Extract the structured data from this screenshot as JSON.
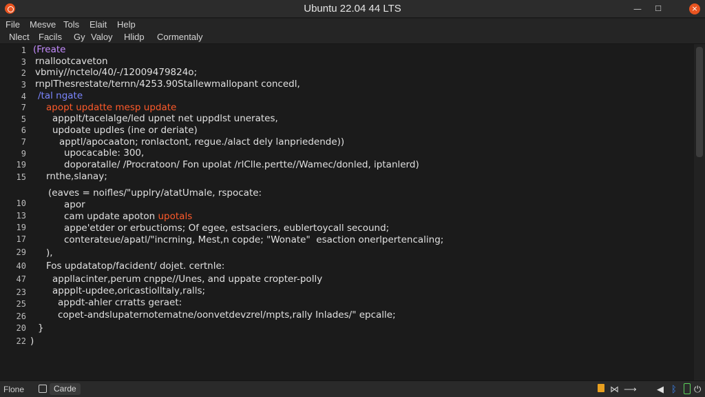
{
  "window": {
    "title": "Ubuntu 22.04 44 LTS",
    "minimize_glyph": "—",
    "maximize_glyph": "☐",
    "close_glyph": "×"
  },
  "menubar": [
    "File",
    "Mesve",
    "Tols",
    "Elait",
    "Help"
  ],
  "toolbar": [
    "Nlect",
    "Facils",
    "Gy",
    "Valoy",
    "Hlidp",
    "Cormentaly"
  ],
  "editor": {
    "line_numbers": [
      "1",
      "3",
      "2",
      "3",
      "4",
      "7",
      "5",
      "6",
      "7",
      "9",
      "19",
      "15",
      "10",
      "13",
      "19",
      "17",
      "29",
      "40",
      "47",
      "23",
      "25",
      "26",
      "20",
      "22"
    ],
    "lines": [
      "(Freate",
      "rnallootcaveton",
      "vbmiy//nctelo/40/-/12009479824o;",
      "rnplThesrestate/ternn/4253.90Stallewmallopant concedl,",
      "/tal ngate",
      "apopt updatte mesp update",
      "appplt/tacelalge/led upnet net uppdlst unerates,",
      "updoate updles (ine or deriate)",
      "apptl/apocaaton; ronlactont, regue./alact dely lanpriedende))",
      "upocacable: 300,",
      "doporatalle/ /Procratoon/ Fon upolat /rlClle.pertte//Wamec/donled, iptanlerd)",
      "rnthe,slanay;",
      "(eaves = noifles/\"upplry/atatUmale, rspocate:",
      "apor",
      "cam update apoton ",
      "upotals",
      "appe'etder or erbuctioms; Of egee, estsaciers, eublertoycall secound;",
      "conterateue/apatl/\"incrning, Mest,n copde; \"Wonate\"  esaction onerlpertencaling;",
      "),",
      "Fos updatatop/facident/ dojet. certnle:",
      "appllacinter,perum cnppe//Unes, and uppate cropter-polly",
      "appplt-updee,oricastiolltaly,ralls;",
      "appdt-ahler crratts geraet:",
      "copet-andslupaternotematne/oonvetdevzrel/mpts,rally Inlades/\" epcalle;",
      "}",
      ")"
    ]
  },
  "statusbar": {
    "left_label": "Flone",
    "button_label": "Carde"
  },
  "tray": {
    "arrow": "⟶",
    "icons": [
      "folder-icon",
      "network-icon",
      "bluetooth-icon",
      "volume-icon",
      "power-icon"
    ]
  },
  "colors": {
    "accent": "#e95420",
    "keyword_purple": "#c58cff",
    "keyword_blue": "#7b86ff",
    "highlight_orange": "#ff5a2a",
    "background": "#1b1b1b"
  }
}
